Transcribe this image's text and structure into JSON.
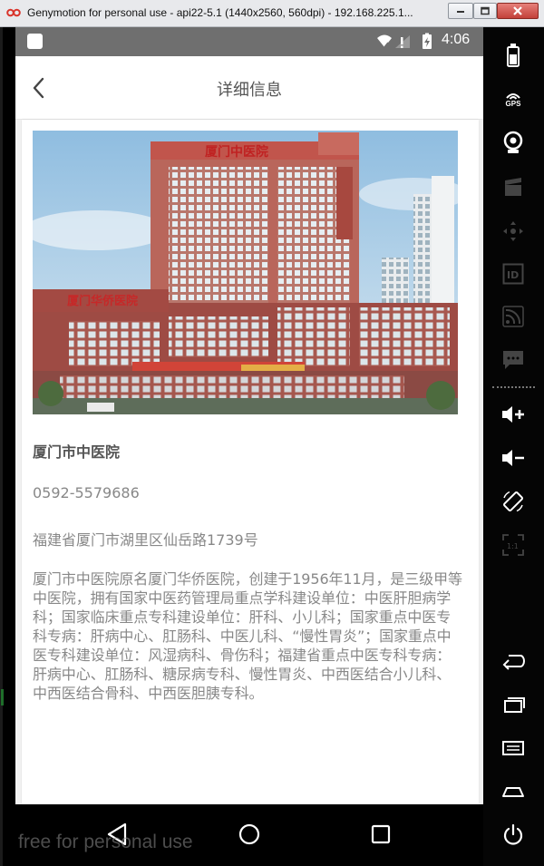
{
  "window": {
    "title": "Genymotion for personal use - api22-5.1 (1440x2560, 560dpi) - 192.168.225.1..."
  },
  "statusbar": {
    "time": "4:06"
  },
  "header": {
    "title": "详细信息"
  },
  "hospital": {
    "name": "厦门市中医院",
    "phone": "0592-5579686",
    "address": "福建省厦门市湖里区仙岳路1739号",
    "description": "厦门市中医院原名厦门华侨医院，创建于1956年11月，是三级甲等中医院，拥有国家中医药管理局重点学科建设单位：中医肝胆病学科；国家临床重点专科建设单位：肝科、小儿科；国家重点中医专科专病：肝病中心、肛肠科、中医儿科、“慢性胃炎”；国家重点中医专科建设单位：风湿病科、骨伤科；福建省重点中医专科专病：肝病中心、肛肠科、糖尿病专科、慢性胃炎、中西医结合小儿科、中西医结合骨科、中西医胆胰专科。",
    "photo_sign_main": "厦门中医院",
    "photo_sign_side": "厦门华侨医院"
  },
  "sidebar": {
    "gps_label": "GPS",
    "id_label": "ID",
    "scale_label": "1:1"
  },
  "watermark": "free for personal use",
  "colors": {
    "statusbar": "#6f6f6f",
    "header_title": "#555555",
    "body_text": "#888888",
    "sidebar_bg": "#050505"
  }
}
